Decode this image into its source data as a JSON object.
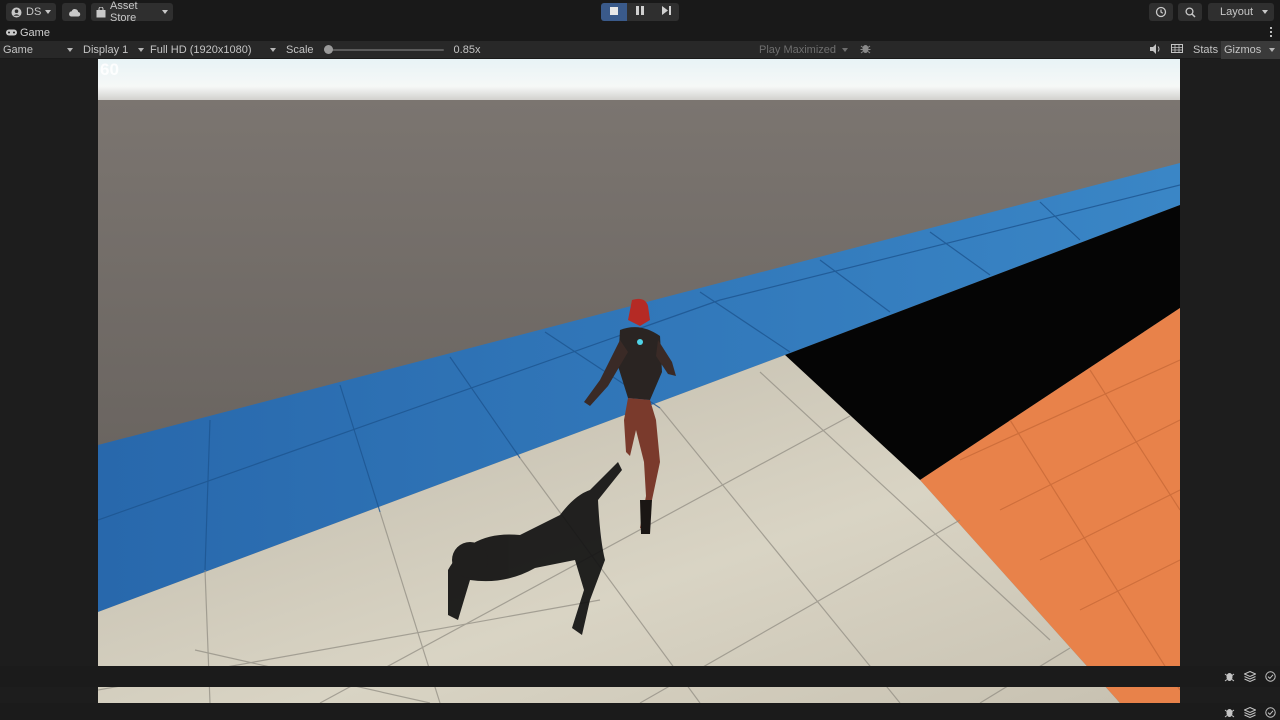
{
  "toolbar": {
    "account_label": "DS",
    "asset_store_label": "Asset Store",
    "layout_label": "Layout"
  },
  "tab": {
    "title": "Game"
  },
  "controls": {
    "view_mode": "Game",
    "display": "Display 1",
    "resolution": "Full HD (1920x1080)",
    "scale_label": "Scale",
    "scale_value": "0.85x",
    "scale_fraction": 0.0,
    "play_mode": "Play Maximized",
    "stats_label": "Stats",
    "gizmos_label": "Gizmos"
  },
  "game": {
    "fps": "60"
  },
  "colors": {
    "accent": "#3a5a8a",
    "blue_walkway": "#2a6fb0",
    "orange_floor": "#e8824a",
    "light_floor": "#c9c4b6",
    "ground": "#6a6562"
  },
  "icons": {
    "account": "account-icon",
    "cloud": "cloud-icon",
    "store": "shopping-bag-icon",
    "history": "history-icon",
    "search": "search-icon",
    "stop": "stop-icon",
    "pause": "pause-icon",
    "step": "step-icon",
    "audio": "audio-icon",
    "aspect": "aspect-grid-icon",
    "bug": "bug-icon",
    "layers": "layers-icon",
    "check": "check-circle-icon"
  }
}
